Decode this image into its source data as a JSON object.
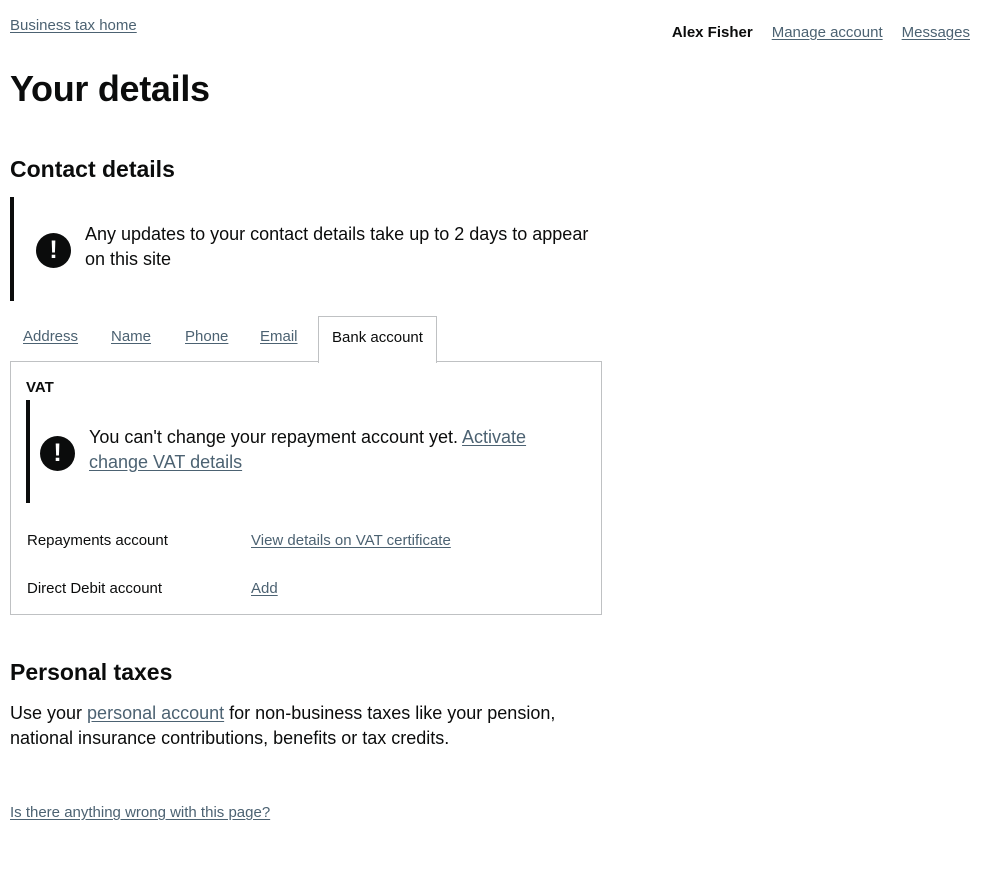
{
  "header": {
    "home_link": "Business tax home",
    "user_name": "Alex Fisher",
    "manage_account": "Manage account",
    "messages": "Messages"
  },
  "page": {
    "title": "Your details"
  },
  "contact": {
    "title": "Contact details",
    "warning_icon": "!",
    "warning_text": "Any updates to your contact details take up to 2 days to appear on this site",
    "tabs": [
      {
        "label": "Address",
        "active": false
      },
      {
        "label": "Name",
        "active": false
      },
      {
        "label": "Phone",
        "active": false
      },
      {
        "label": "Email",
        "active": false
      },
      {
        "label": "Bank account",
        "active": true
      }
    ],
    "panel": {
      "heading": "VAT",
      "warning_icon": "!",
      "warning_text": "You can't change your repayment account yet.",
      "warning_link": "Activate change VAT details",
      "rows": [
        {
          "key": "Repayments account",
          "value": "View details on VAT certificate"
        },
        {
          "key": "Direct Debit account",
          "value": "Add"
        }
      ]
    }
  },
  "personal": {
    "title": "Personal taxes",
    "text_before": "Use your",
    "link": "personal account",
    "text_after": "for non-business taxes like your pension, national insurance contributions, benefits or tax credits."
  },
  "footer": {
    "report_link": "Is there anything wrong with this page?"
  },
  "colors": {
    "text": "#0b0c0c",
    "link": "#4c6272",
    "border": "#bfc1c3"
  }
}
